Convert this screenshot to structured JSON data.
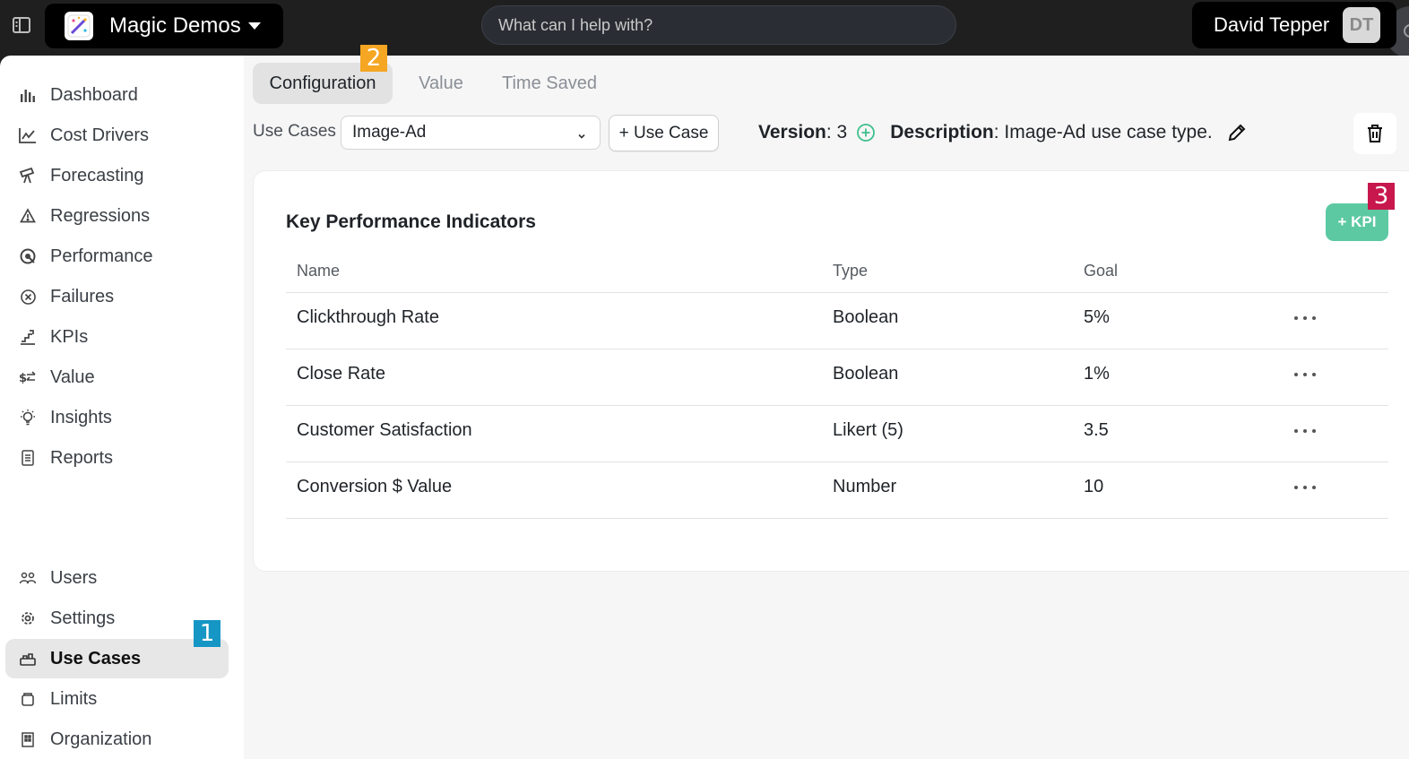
{
  "header": {
    "workspace_name": "Magic Demos",
    "search_placeholder": "What can I help with?",
    "user_name": "David Tepper",
    "user_initials": "DT"
  },
  "sidebar": {
    "items": [
      {
        "label": "Dashboard",
        "icon": "bar-chart-icon"
      },
      {
        "label": "Cost Drivers",
        "icon": "line-chart-icon"
      },
      {
        "label": "Forecasting",
        "icon": "telescope-icon"
      },
      {
        "label": "Regressions",
        "icon": "warning-triangle-icon"
      },
      {
        "label": "Performance",
        "icon": "gauge-icon"
      },
      {
        "label": "Failures",
        "icon": "x-circle-icon"
      },
      {
        "label": "KPIs",
        "icon": "stairs-chart-icon"
      },
      {
        "label": "Value",
        "icon": "dollar-exchange-icon"
      },
      {
        "label": "Insights",
        "icon": "lightbulb-icon"
      },
      {
        "label": "Reports",
        "icon": "document-icon"
      },
      {
        "label": "Users",
        "icon": "users-icon"
      },
      {
        "label": "Settings",
        "icon": "gear-icon"
      },
      {
        "label": "Use Cases",
        "icon": "use-cases-icon",
        "active": true
      },
      {
        "label": "Limits",
        "icon": "jar-icon"
      },
      {
        "label": "Organization",
        "icon": "building-icon"
      }
    ]
  },
  "tabs": [
    {
      "label": "Configuration",
      "active": true
    },
    {
      "label": "Value"
    },
    {
      "label": "Time Saved"
    }
  ],
  "toolbar": {
    "use_cases_label": "Use Cases",
    "selected_use_case": "Image-Ad",
    "add_use_case_label": "+ Use Case",
    "version_label": "Version",
    "version_value": ": 3",
    "description_label": "Description",
    "description_value": ": Image-Ad use case type."
  },
  "kpi_card": {
    "title": "Key Performance Indicators",
    "add_button_label": "+ KPI",
    "columns": [
      "Name",
      "Type",
      "Goal"
    ],
    "rows": [
      {
        "name": "Clickthrough Rate",
        "type": "Boolean",
        "goal": "5%"
      },
      {
        "name": "Close Rate",
        "type": "Boolean",
        "goal": "1%"
      },
      {
        "name": "Customer Satisfaction",
        "type": "Likert (5)",
        "goal": "3.5"
      },
      {
        "name": "Conversion $ Value",
        "type": "Number",
        "goal": "10"
      }
    ]
  },
  "annotations": {
    "badge_1": "1",
    "badge_2": "2",
    "badge_3": "3"
  },
  "colors": {
    "accent_green": "#5cc9a3",
    "badge_blue": "#1596c4",
    "badge_orange": "#f5a623",
    "badge_red": "#c8174d"
  }
}
